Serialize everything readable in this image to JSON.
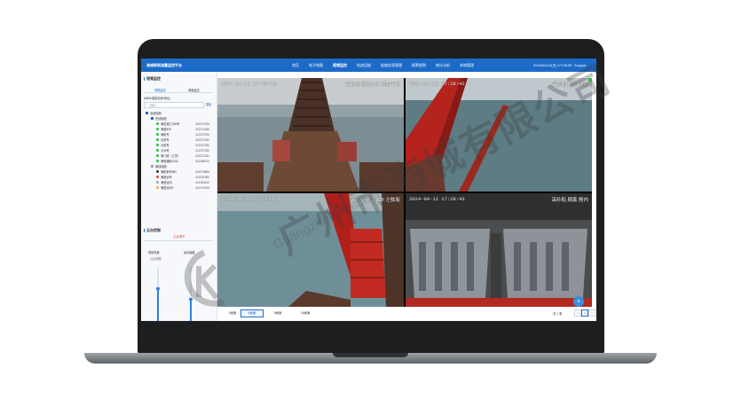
{
  "app": {
    "title": "海城联网测量监控平台",
    "nav": [
      "首页",
      "电子地图",
      "视频监控",
      "轨迹回放",
      "船舶信息管理",
      "报警规则",
      "统计分析",
      "系统管理"
    ],
    "active_nav": "视频监控",
    "clock": "2024/04/12(五) 17:28:39",
    "user": "Scrpple"
  },
  "sidebar": {
    "monitor_title": "视频监控",
    "tabs": [
      "视频监控",
      "录像监控"
    ],
    "mmsi_label": "MMSI/船舶名称/地址：",
    "search_placeholder": "请输入",
    "search_button": "搜索",
    "tree": [
      {
        "level": 0,
        "label": "全部船舶",
        "code": "",
        "color": "#1c6bc9"
      },
      {
        "level": 1,
        "label": "在线船舶",
        "code": "",
        "color": "#1c6bc9"
      },
      {
        "level": 2,
        "label": "海岩通工328号",
        "code": "413219786",
        "color": "#27c24c"
      },
      {
        "level": 2,
        "label": "海盛828",
        "code": "413220188",
        "color": "#27c24c"
      },
      {
        "level": 2,
        "label": "海航号",
        "code": "413237290",
        "color": "#27c24c"
      },
      {
        "level": 2,
        "label": "合资号",
        "code": "413237360",
        "color": "#27c24c"
      },
      {
        "level": 2,
        "label": "大锐号",
        "code": "413237280",
        "color": "#27c24c"
      },
      {
        "level": 2,
        "label": "五洲号",
        "code": "413237350",
        "color": "#27c24c"
      },
      {
        "level": 2,
        "label": "海门威（江苏）",
        "code": "413237281",
        "color": "#27c24c"
      },
      {
        "level": 2,
        "label": "海城通航3152",
        "code": "413488070",
        "color": "#27c24c"
      },
      {
        "level": 1,
        "label": "离线船舶",
        "code": "",
        "color": "#9aa3ad"
      },
      {
        "level": 2,
        "label": "海航新号862",
        "code": "413276896",
        "color": "#333333"
      },
      {
        "level": 2,
        "label": "海盛远号",
        "code": "413201982",
        "color": "#e74c3c"
      },
      {
        "level": 2,
        "label": "海盛运河",
        "code": "413284440",
        "color": "#9aa3ad"
      },
      {
        "level": 2,
        "label": "海盛运河2",
        "code": "413241925",
        "color": "#f0ad4e"
      }
    ],
    "control_title": "云台控制",
    "control_tab": "云台调节",
    "controls": [
      {
        "label": "视场设置",
        "sub": "云台调整",
        "level": 0.6
      },
      {
        "label": "运动速度",
        "sub": "",
        "level": 0.4
      }
    ]
  },
  "cameras": [
    {
      "timestamp": "2024-04-12 17:28:40",
      "name": "采砂船 顺鑫828 前面甲板",
      "scene": "dredger-deck"
    },
    {
      "timestamp": "2024-04-12 17:28:42",
      "name": "采砂船 顺鑫 后面",
      "scene": "red-arm"
    },
    {
      "timestamp": "2024-04-12 17:28:43",
      "name": "采砂船 顺鑫828 左舷尾",
      "scene": "red-arm-wide"
    },
    {
      "timestamp": "2024-04-12 17:28:43",
      "name": "采砂船 顺鑫 舱内",
      "scene": "hold"
    }
  ],
  "footer": {
    "layouts": [
      "1画面",
      "4画面",
      "9画面",
      "16画面"
    ],
    "active_layout": "4画面",
    "total": "共 1 条",
    "pages": [
      "<",
      "1",
      ">"
    ]
  },
  "watermark": {
    "cn": "广州市海城有限公司",
    "en": "Guangzhou Haicheng Co., Ltd."
  },
  "colors": {
    "topbar": "#1c6bc9",
    "online": "#27c24c",
    "offline": "#9aa3ad",
    "alert": "#e74c3c"
  }
}
